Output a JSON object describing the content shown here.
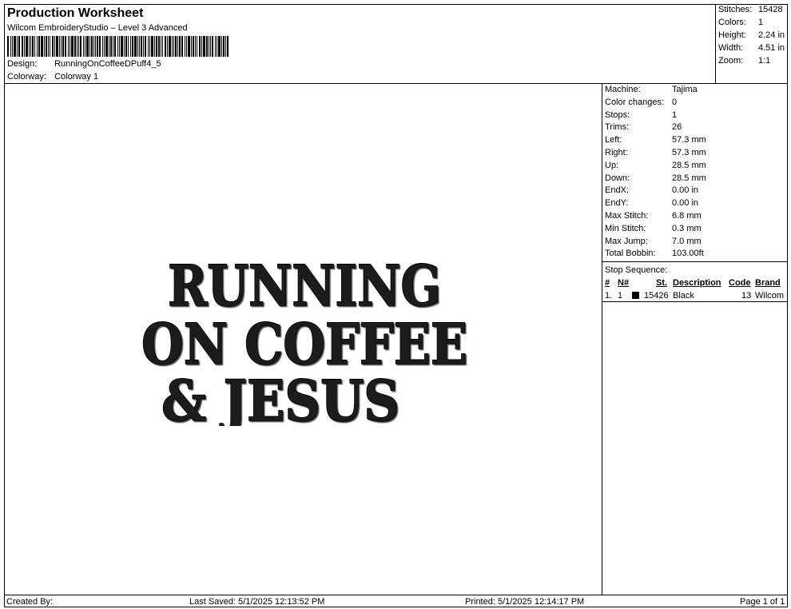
{
  "header": {
    "title": "Production Worksheet",
    "software": "Wilcom EmbroideryStudio – Level 3 Advanced",
    "design_label": "Design:",
    "design_value": "RunningOnCoffeeDPuff4_5",
    "colorway_label": "Colorway:",
    "colorway_value": "Colorway 1"
  },
  "summary": {
    "stitches_label": "Stitches:",
    "stitches_value": "15428",
    "colors_label": "Colors:",
    "colors_value": "1",
    "height_label": "Height:",
    "height_value": "2.24 in",
    "width_label": "Width:",
    "width_value": "4.51 in",
    "zoom_label": "Zoom:",
    "zoom_value": "1:1"
  },
  "artwork": {
    "line1": "RUNNING",
    "line2": "ON COFFEE",
    "line3": "& JESUS",
    "thread_color": "#1a1a1a"
  },
  "machine_info": [
    {
      "label": "Machine:",
      "value": "Tajima"
    },
    {
      "label": "Color changes:",
      "value": "0"
    },
    {
      "label": "Stops:",
      "value": "1"
    },
    {
      "label": "Trims:",
      "value": "26"
    },
    {
      "label": "Left:",
      "value": "57.3 mm"
    },
    {
      "label": "Right:",
      "value": "57.3 mm"
    },
    {
      "label": "Up:",
      "value": "28.5 mm"
    },
    {
      "label": "Down:",
      "value": "28.5 mm"
    },
    {
      "label": "EndX:",
      "value": "0.00 in"
    },
    {
      "label": "EndY:",
      "value": "0.00 in"
    },
    {
      "label": "Max Stitch:",
      "value": "6.8 mm"
    },
    {
      "label": "Min Stitch:",
      "value": "0.3 mm"
    },
    {
      "label": "Max Jump:",
      "value": "7.0 mm"
    },
    {
      "label": "Total Bobbin:",
      "value": "103.00ft"
    }
  ],
  "stop_sequence": {
    "title": "Stop Sequence:",
    "columns": [
      "#",
      "N#",
      "St.",
      "Description",
      "Code",
      "Brand"
    ],
    "rows": [
      {
        "index": "1.",
        "needle": "1",
        "swatch_color": "#000000",
        "stitches": "15426",
        "description": "Black",
        "code": "13",
        "brand": "Wilcom"
      }
    ]
  },
  "footer": {
    "created_by": "Created By:",
    "last_saved": "Last Saved: 5/1/2025 12:13:52 PM",
    "printed": "Printed: 5/1/2025 12:14:17 PM",
    "page": "Page 1 of 1"
  }
}
